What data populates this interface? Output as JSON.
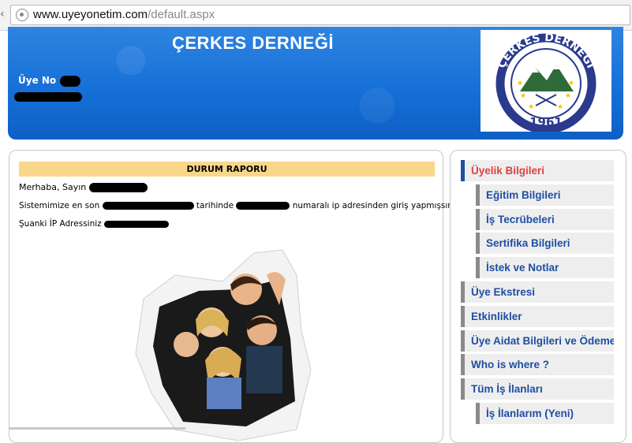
{
  "browser": {
    "url_host": "www.uyeyonetim.com",
    "url_path": "/default.aspx"
  },
  "header": {
    "title": "ÇERKES DERNEĞİ",
    "member_no_label": "Üye No :",
    "logo": {
      "top_text": "ÇERKES DERNEĞİ",
      "year": "1961"
    }
  },
  "report": {
    "heading": "DURUM RAPORU",
    "greeting": "Merhaba, Sayın",
    "last_login_prefix": "Sistemimize en son",
    "last_login_middle": "tarihinde",
    "last_login_suffix": "numaralı ip adresinden giriş yapmışsınız.",
    "current_ip_label": "Şuanki İP Adressiniz"
  },
  "menu": {
    "items": [
      {
        "label": "Üyelik Bilgileri",
        "level": "top",
        "active": true
      },
      {
        "label": "Eğitim Bilgileri",
        "level": "sub",
        "active": false
      },
      {
        "label": "İş Tecrübeleri",
        "level": "sub",
        "active": false
      },
      {
        "label": "Sertifika Bilgileri",
        "level": "sub",
        "active": false
      },
      {
        "label": "İstek ve Notlar",
        "level": "sub",
        "active": false
      },
      {
        "label": "Üye Ekstresi",
        "level": "top",
        "active": false
      },
      {
        "label": "Etkinlikler",
        "level": "top",
        "active": false
      },
      {
        "label": "Üye Aidat Bilgileri ve Ödeme",
        "level": "top",
        "active": false
      },
      {
        "label": "Who is where ?",
        "level": "top",
        "active": false
      },
      {
        "label": "Tüm İş İlanları",
        "level": "top",
        "active": false
      },
      {
        "label": "İş İlanlarım (Yeni)",
        "level": "sub",
        "active": false
      }
    ]
  },
  "colors": {
    "header_blue": "#1670d8",
    "menu_text": "#1f4ea3",
    "menu_active_text": "#e04040",
    "report_heading_bg": "#f8d78b"
  }
}
